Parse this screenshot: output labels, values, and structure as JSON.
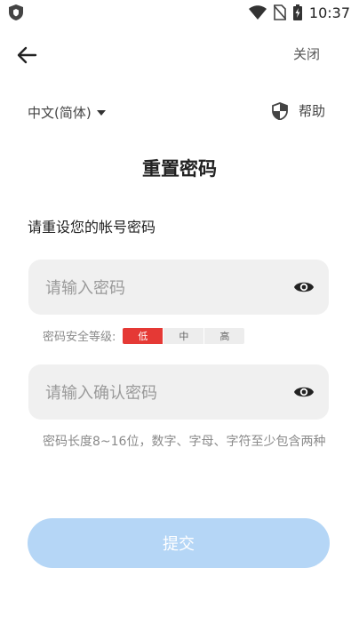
{
  "status_bar": {
    "time": "10:37"
  },
  "nav": {
    "close_label": "关闭"
  },
  "language": {
    "selected": "中文(简体)"
  },
  "help": {
    "label": "帮助"
  },
  "page": {
    "title": "重置密码",
    "instruction": "请重设您的帐号密码"
  },
  "form": {
    "password_placeholder": "请输入密码",
    "password_value": "",
    "confirm_placeholder": "请输入确认密码",
    "confirm_value": "",
    "strength_label": "密码安全等级:",
    "strength_levels": [
      "低",
      "中",
      "高"
    ],
    "strength_current": "低",
    "hint": "密码长度8~16位，数字、字母、字符至少包含两种",
    "submit_label": "提交"
  },
  "colors": {
    "accent_disabled": "#b5d6f6",
    "strength_low": "#e53935",
    "field_bg": "#f0f0f0"
  },
  "icons": {
    "status_app": "shield-app-icon",
    "wifi": "wifi-icon",
    "no_sim": "no-sim-icon",
    "battery": "battery-charging-icon",
    "back": "arrow-left-icon",
    "help": "shield-half-icon",
    "visibility": "eye-icon"
  }
}
